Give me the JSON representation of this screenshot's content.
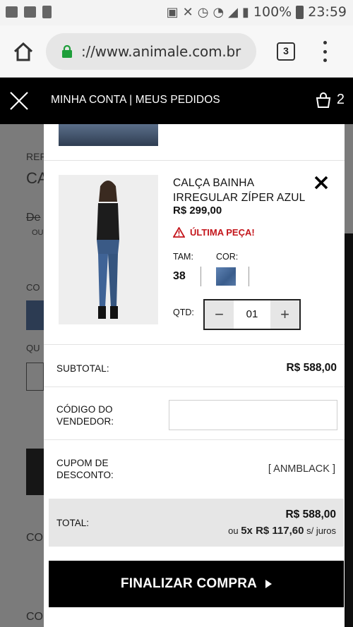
{
  "status_bar": {
    "battery": "100%",
    "time": "23:59"
  },
  "browser": {
    "url": "://www.animale.com.br",
    "tab_count": "3"
  },
  "header": {
    "my_account": "MINHA CONTA",
    "divider": "|",
    "my_orders": "MEUS PEDIDOS",
    "bag_count": "2"
  },
  "background_page": {
    "ref": "REF",
    "title_fragment": "CA",
    "old_price_fragment": "De",
    "or_fragment": "OU",
    "color_fragment": "CO",
    "qty_fragment": "QU",
    "footer_fragment_1": "CO",
    "footer_fragment_2": "CO"
  },
  "cart_item": {
    "name": "CALÇA BAINHA IRREGULAR ZÍPER AZUL",
    "price": "R$ 299,00",
    "alert": "ÚLTIMA PEÇA!",
    "size_label": "TAM:",
    "size_value": "38",
    "color_label": "COR:",
    "qty_label": "QTD:",
    "qty_value": "01",
    "qty_minus": "−",
    "qty_plus": "+"
  },
  "summary": {
    "subtotal_label": "SUBTOTAL:",
    "subtotal_value": "R$ 588,00",
    "vendor_label_1": "CÓDIGO DO",
    "vendor_label_2": "VENDEDOR:",
    "coupon_label_1": "CUPOM DE",
    "coupon_label_2": "DESCONTO:",
    "coupon_value": "[ ANMBLACK ]",
    "total_label": "TOTAL:",
    "total_value": "R$ 588,00",
    "installments_prefix": "ou",
    "installments_value": "5x R$ 117,60",
    "installments_suffix": "s/ juros"
  },
  "checkout": {
    "label": "FINALIZAR COMPRA"
  },
  "colors": {
    "header_bg": "#000000",
    "alert_red": "#c4161c",
    "total_bg": "#e6e6e6",
    "swatch": "#3f6396"
  }
}
